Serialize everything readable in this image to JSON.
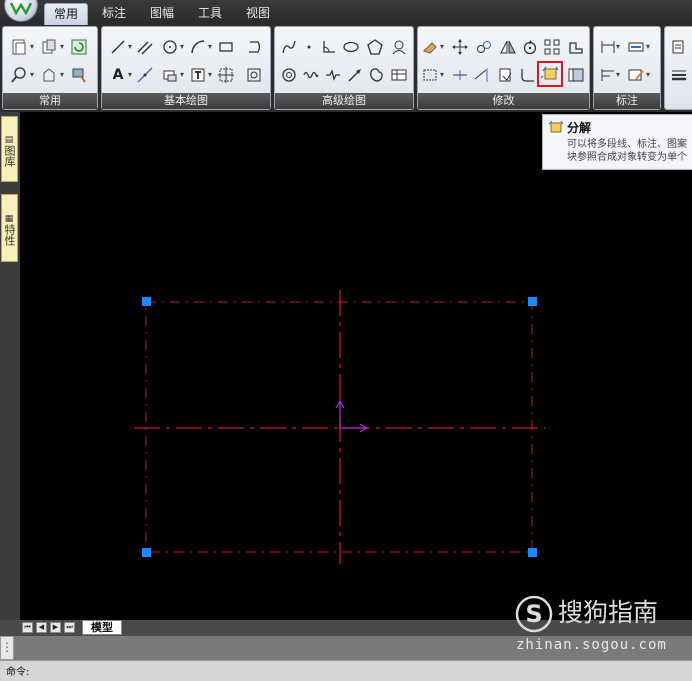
{
  "ribbon_tabs": [
    "常用",
    "标注",
    "图幅",
    "工具",
    "视图"
  ],
  "active_tab": "常用",
  "panels": {
    "common": "常用",
    "basic_draw": "基本绘图",
    "advanced_draw": "高级绘图",
    "modify": "修改",
    "dimension": "标注"
  },
  "tooltip": {
    "title": "分解",
    "line1": "可以将多段线、标注、图案",
    "line2": "块参照合成对象转变为单个"
  },
  "side_tabs": [
    "图库",
    "特性"
  ],
  "layout_tab": "模型",
  "command_prompt": "命令:",
  "watermark": {
    "brand": "搜狗指南",
    "url": "zhinan.sogou.com"
  },
  "colors": {
    "centerline": "#c8163c",
    "rectangle": "#c8163c",
    "grip": "#1e88ff",
    "ucs": "#b030c8",
    "highlight": "#e0141c"
  }
}
